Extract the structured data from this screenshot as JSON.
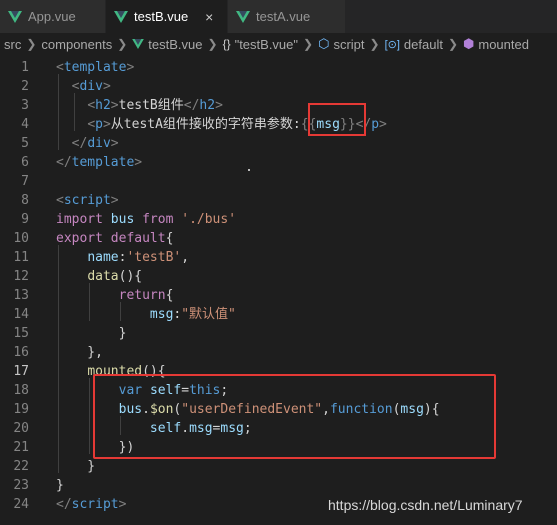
{
  "tabs": [
    {
      "label": "App.vue",
      "icon": "vue-icon",
      "active": false
    },
    {
      "label": "testB.vue",
      "icon": "vue-icon",
      "active": true,
      "close": "×"
    },
    {
      "label": "testA.vue",
      "icon": "vue-icon",
      "active": false
    }
  ],
  "breadcrumb": {
    "src": "src",
    "components": "components",
    "file": "testB.vue",
    "braces": "{}",
    "name": "\"testB.vue\"",
    "script": "script",
    "default": "default",
    "mounted": "mounted"
  },
  "lines": [
    {
      "n": "1",
      "segs": [
        [
          "t-br",
          "<"
        ],
        [
          "t-tag",
          "template"
        ],
        [
          "t-br",
          ">"
        ]
      ]
    },
    {
      "n": "2",
      "segs": [
        [
          "t-txt",
          "  "
        ],
        [
          "t-br",
          "<"
        ],
        [
          "t-tag",
          "div"
        ],
        [
          "t-br",
          ">"
        ]
      ]
    },
    {
      "n": "3",
      "segs": [
        [
          "t-txt",
          "    "
        ],
        [
          "t-br",
          "<"
        ],
        [
          "t-tag",
          "h2"
        ],
        [
          "t-br",
          ">"
        ],
        [
          "t-txt",
          "testB组件"
        ],
        [
          "t-br",
          "</"
        ],
        [
          "t-tag",
          "h2"
        ],
        [
          "t-br",
          ">"
        ]
      ]
    },
    {
      "n": "4",
      "segs": [
        [
          "t-txt",
          "    "
        ],
        [
          "t-br",
          "<"
        ],
        [
          "t-tag",
          "p"
        ],
        [
          "t-br",
          ">"
        ],
        [
          "t-txt",
          "从testA组件接收的字符串参数:"
        ],
        [
          "t-br",
          "{{"
        ],
        [
          "t-var",
          "msg"
        ],
        [
          "t-br",
          "}}"
        ],
        [
          "t-br",
          "</"
        ],
        [
          "t-tag",
          "p"
        ],
        [
          "t-br",
          ">"
        ]
      ]
    },
    {
      "n": "5",
      "segs": [
        [
          "t-txt",
          "  "
        ],
        [
          "t-br",
          "</"
        ],
        [
          "t-tag",
          "div"
        ],
        [
          "t-br",
          ">"
        ]
      ]
    },
    {
      "n": "6",
      "segs": [
        [
          "t-br",
          "</"
        ],
        [
          "t-tag",
          "template"
        ],
        [
          "t-br",
          ">"
        ]
      ]
    },
    {
      "n": "7",
      "segs": []
    },
    {
      "n": "8",
      "segs": [
        [
          "t-br",
          "<"
        ],
        [
          "t-tag",
          "script"
        ],
        [
          "t-br",
          ">"
        ]
      ]
    },
    {
      "n": "9",
      "segs": [
        [
          "t-kw",
          "import"
        ],
        [
          "t-txt",
          " "
        ],
        [
          "t-var",
          "bus"
        ],
        [
          "t-txt",
          " "
        ],
        [
          "t-kw",
          "from"
        ],
        [
          "t-txt",
          " "
        ],
        [
          "t-str",
          "'./bus'"
        ]
      ]
    },
    {
      "n": "10",
      "segs": [
        [
          "t-kw",
          "export"
        ],
        [
          "t-txt",
          " "
        ],
        [
          "t-kw",
          "default"
        ],
        [
          "t-txt",
          "{"
        ]
      ]
    },
    {
      "n": "11",
      "segs": [
        [
          "t-txt",
          "    "
        ],
        [
          "t-var",
          "name"
        ],
        [
          "t-txt",
          ":"
        ],
        [
          "t-str",
          "'testB'"
        ],
        [
          "t-txt",
          ","
        ]
      ]
    },
    {
      "n": "12",
      "segs": [
        [
          "t-txt",
          "    "
        ],
        [
          "t-fn",
          "data"
        ],
        [
          "t-txt",
          "(){"
        ]
      ]
    },
    {
      "n": "13",
      "segs": [
        [
          "t-txt",
          "        "
        ],
        [
          "t-kw",
          "return"
        ],
        [
          "t-txt",
          "{"
        ]
      ]
    },
    {
      "n": "14",
      "segs": [
        [
          "t-txt",
          "            "
        ],
        [
          "t-var",
          "msg"
        ],
        [
          "t-txt",
          ":"
        ],
        [
          "t-str",
          "\"默认值\""
        ]
      ]
    },
    {
      "n": "15",
      "segs": [
        [
          "t-txt",
          "        }"
        ]
      ]
    },
    {
      "n": "16",
      "segs": [
        [
          "t-txt",
          "    },"
        ]
      ]
    },
    {
      "n": "17",
      "segs": [
        [
          "t-txt",
          "    "
        ],
        [
          "t-fn",
          "mounted"
        ],
        [
          "t-txt",
          "(){"
        ]
      ]
    },
    {
      "n": "18",
      "segs": [
        [
          "t-txt",
          "        "
        ],
        [
          "t-key",
          "var"
        ],
        [
          "t-txt",
          " "
        ],
        [
          "t-var",
          "self"
        ],
        [
          "t-txt",
          "="
        ],
        [
          "t-key",
          "this"
        ],
        [
          "t-txt",
          ";"
        ]
      ]
    },
    {
      "n": "19",
      "segs": [
        [
          "t-txt",
          "        "
        ],
        [
          "t-var",
          "bus"
        ],
        [
          "t-txt",
          "."
        ],
        [
          "t-fn",
          "$on"
        ],
        [
          "t-txt",
          "("
        ],
        [
          "t-str",
          "\"userDefinedEvent\""
        ],
        [
          "t-txt",
          ","
        ],
        [
          "t-key",
          "function"
        ],
        [
          "t-txt",
          "("
        ],
        [
          "t-var",
          "msg"
        ],
        [
          "t-txt",
          "){"
        ]
      ]
    },
    {
      "n": "20",
      "segs": [
        [
          "t-txt",
          "            "
        ],
        [
          "t-var",
          "self"
        ],
        [
          "t-txt",
          "."
        ],
        [
          "t-var",
          "msg"
        ],
        [
          "t-txt",
          "="
        ],
        [
          "t-var",
          "msg"
        ],
        [
          "t-txt",
          ";"
        ]
      ]
    },
    {
      "n": "21",
      "segs": [
        [
          "t-txt",
          "        })"
        ]
      ]
    },
    {
      "n": "22",
      "segs": [
        [
          "t-txt",
          "    }"
        ]
      ]
    },
    {
      "n": "23",
      "segs": [
        [
          "t-txt",
          "}"
        ]
      ]
    },
    {
      "n": "24",
      "segs": [
        [
          "t-br",
          "</"
        ],
        [
          "t-tag",
          "script"
        ],
        [
          "t-br",
          ">"
        ]
      ]
    }
  ],
  "current_line": "17",
  "watermark": "https://blog.csdn.net/Luminary7",
  "colors": {
    "background": "#1e1e1e",
    "highlight_box": "#e53935",
    "tag": "#569cd6",
    "keyword": "#c586c0",
    "string": "#ce9178",
    "variable": "#9cdcfe",
    "function": "#dcdcaa"
  }
}
